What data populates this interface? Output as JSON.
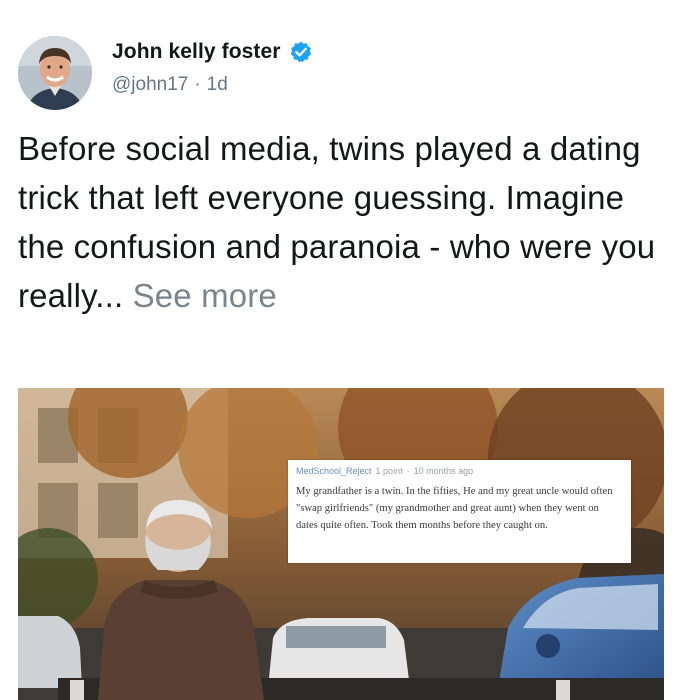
{
  "tweet": {
    "author": {
      "display_name": "John kelly foster",
      "handle": "@john17",
      "separator": "·",
      "age": "1d",
      "verified": true
    },
    "text": "Before social media, twins played a dating trick that left everyone guessing. Imagine the confusion and paranoia - who were you really...",
    "see_more": "See more"
  },
  "media": {
    "comment": {
      "username": "MedSchool_Reject",
      "points": "1 point",
      "separator": "·",
      "age": "10 months ago",
      "body": "My grandfather is a twin. In the fifties, He and my great uncle would often \"swap girlfriends\" (my grandmother and great aunt) when they went on dates quite often. Took them months before they caught on."
    }
  },
  "colors": {
    "text": "#14171a",
    "secondary": "#657786",
    "verified_badge": "#1da1f2",
    "see_more": "#7a848d"
  },
  "icons": {
    "verified": "verified-badge-icon"
  }
}
